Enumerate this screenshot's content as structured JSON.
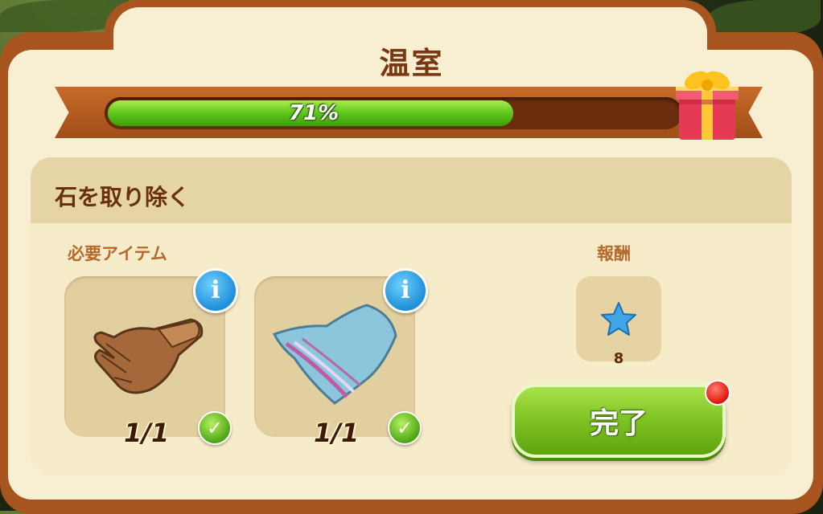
{
  "panel": {
    "title": "温室",
    "progress_label": "71%",
    "progress_value": 0.71
  },
  "task": {
    "name": "石を取り除く",
    "required_label": "必要アイテム",
    "reward_label": "報酬",
    "items": [
      {
        "icon": "glove-icon",
        "count": "1/1"
      },
      {
        "icon": "cloth-icon",
        "count": "1/1"
      }
    ],
    "reward": {
      "icon": "blue-star-icon",
      "amount": "8"
    },
    "complete_button": "完了"
  },
  "colors": {
    "frame": "#a8541f",
    "panel_bg": "#f8efd2",
    "progress_fill": "#58c31a",
    "button_green": "#7ec223",
    "info_blue": "#1f8fd8",
    "notification_red": "#e0160c"
  }
}
